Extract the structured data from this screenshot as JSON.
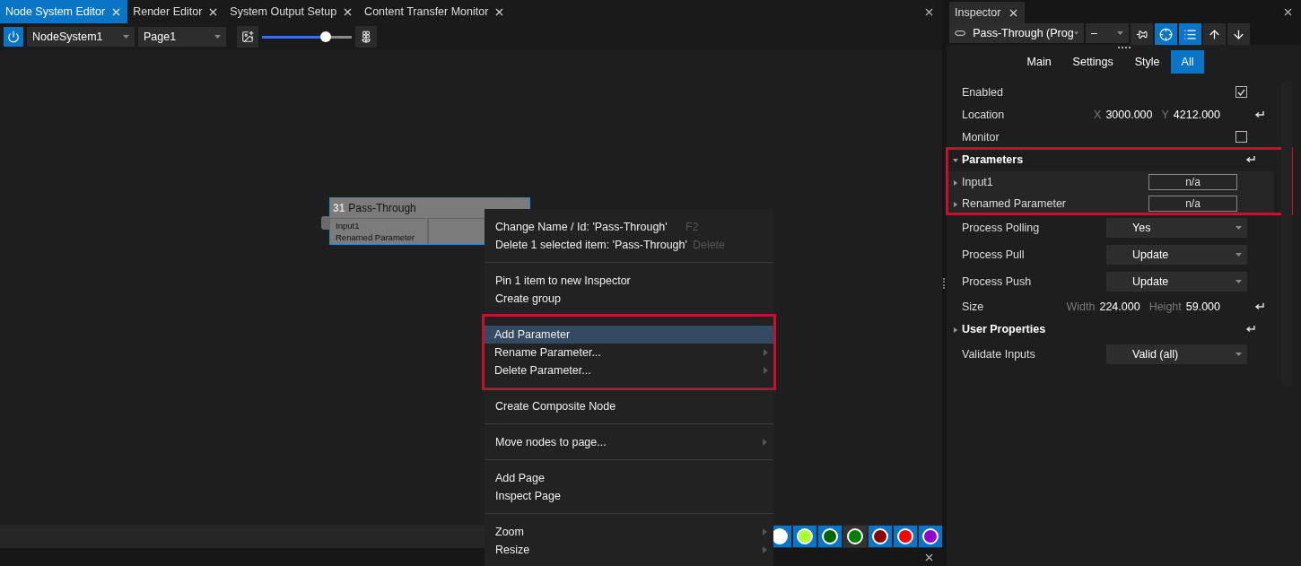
{
  "editor_tabs": [
    {
      "label": "Node System Editor",
      "selected": true
    },
    {
      "label": "Render Editor",
      "selected": false
    },
    {
      "label": "System Output Setup",
      "selected": false
    },
    {
      "label": "Content Transfer Monitor",
      "selected": false
    }
  ],
  "toolbar": {
    "system": "NodeSystem1",
    "page": "Page1",
    "zoom": {
      "level": 0.71
    }
  },
  "node": {
    "number": "31",
    "title": "Pass-Through",
    "selected": true,
    "inputs": [
      "Input1",
      "Renamed Parameter"
    ]
  },
  "context_menu": {
    "groups": [
      {
        "highlighted": false,
        "items": [
          {
            "label": "Change Name / Id: 'Pass-Through'",
            "shortcut": "F2",
            "submenu": false,
            "selected": false
          },
          {
            "label": "Delete 1 selected item: 'Pass-Through'",
            "shortcut": "Delete",
            "submenu": false,
            "selected": false
          }
        ]
      },
      {
        "highlighted": false,
        "items": [
          {
            "label": "Pin 1 item to new Inspector",
            "submenu": false,
            "selected": false
          },
          {
            "label": "Create group",
            "submenu": false,
            "selected": false
          }
        ]
      },
      {
        "highlighted": true,
        "items": [
          {
            "label": "Add Parameter",
            "submenu": false,
            "selected": true
          },
          {
            "label": "Rename Parameter...",
            "submenu": true,
            "selected": false
          },
          {
            "label": "Delete Parameter...",
            "submenu": true,
            "selected": false
          }
        ]
      },
      {
        "highlighted": false,
        "items": [
          {
            "label": "Create Composite Node",
            "submenu": false,
            "selected": false
          }
        ]
      },
      {
        "highlighted": false,
        "items": [
          {
            "label": "Move nodes to page...",
            "submenu": true,
            "selected": false
          }
        ]
      },
      {
        "highlighted": false,
        "items": [
          {
            "label": "Add Page",
            "submenu": false,
            "selected": false
          },
          {
            "label": "Inspect Page",
            "submenu": false,
            "selected": false
          }
        ]
      },
      {
        "highlighted": false,
        "items": [
          {
            "label": "Zoom",
            "submenu": true,
            "selected": false
          },
          {
            "label": "Resize",
            "submenu": true,
            "selected": false
          }
        ]
      }
    ]
  },
  "color_swatches": [
    {
      "color": "#ffffff",
      "selected": false
    },
    {
      "color": "#adff2f",
      "selected": false
    },
    {
      "color": "#006400",
      "selected": false
    },
    {
      "color": "#008000",
      "selected": true
    },
    {
      "color": "#8b0000",
      "selected": false
    },
    {
      "color": "#ff0000",
      "selected": false
    },
    {
      "color": "#9400d3",
      "selected": false
    }
  ],
  "inspector": {
    "title": "Inspector",
    "object": "Pass-Through (Prog",
    "dash": "–",
    "buttons": [
      {
        "kind": "pin",
        "on": false
      },
      {
        "kind": "target",
        "on": true
      },
      {
        "kind": "list",
        "on": true
      },
      {
        "kind": "up",
        "on": false
      },
      {
        "kind": "down",
        "on": false
      }
    ],
    "tabs": [
      {
        "label": "Main",
        "selected": false
      },
      {
        "label": "Settings",
        "selected": false
      },
      {
        "label": "Style",
        "selected": false
      },
      {
        "label": "All",
        "selected": true
      }
    ],
    "rows": [
      {
        "kind": "checkbox",
        "label": "Enabled",
        "checked": true
      },
      {
        "kind": "pair",
        "label": "Location",
        "a_label": "X",
        "a_value": "3000.000",
        "b_label": "Y",
        "b_value": "4212.000",
        "reset": true
      },
      {
        "kind": "checkbox",
        "label": "Monitor",
        "checked": false
      },
      {
        "kind": "section",
        "label": "Parameters",
        "expanded": true,
        "highlighted": true,
        "reset": true,
        "children": [
          {
            "label": "Input1",
            "value": "n/a",
            "expanded": false
          },
          {
            "label": "Renamed Parameter",
            "value": "n/a",
            "expanded": false
          }
        ]
      },
      {
        "kind": "dropdown",
        "label": "Process Polling",
        "value": "Yes"
      },
      {
        "kind": "dropdown",
        "label": "Process Pull",
        "value": "Update"
      },
      {
        "kind": "dropdown",
        "label": "Process Push",
        "value": "Update"
      },
      {
        "kind": "pair",
        "label": "Size",
        "a_label": "Width",
        "a_value": "224.000",
        "b_label": "Height",
        "b_value": "59.000",
        "reset": true
      },
      {
        "kind": "section",
        "label": "User Properties",
        "expanded": false,
        "highlighted": false,
        "reset": true
      },
      {
        "kind": "dropdown",
        "label": "Validate Inputs",
        "value": "Valid (all)"
      }
    ]
  }
}
